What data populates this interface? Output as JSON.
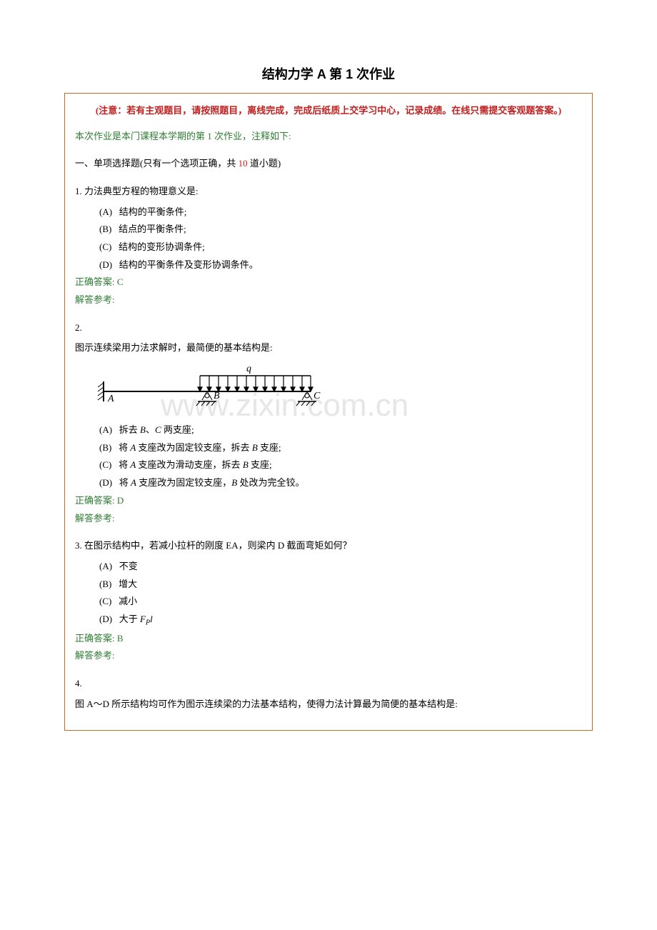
{
  "title": "结构力学 A 第 1 次作业",
  "notice": "(注意：若有主观题目，请按照题目，离线完成，完成后纸质上交学习中心，记录成绩。在线只需提交客观题答案。)",
  "intro": "本次作业是本门课程本学期的第 1 次作业，注释如下:",
  "section_head_pre": "一、单项选择题(只有一个选项正确，共 ",
  "section_head_count": "10",
  "section_head_post": " 道小题)",
  "q1": {
    "num": "1.",
    "stem": "力法典型方程的物理意义是:",
    "opts": {
      "A": "(A)   结构的平衡条件;",
      "B": "(B)   结点的平衡条件;",
      "C": "(C)   结构的变形协调条件;",
      "D": "(D)   结构的平衡条件及变形协调条件。"
    },
    "answer": "正确答案: C",
    "ref": "解答参考:"
  },
  "q2": {
    "num": "2.",
    "stem": "图示连续梁用力法求解时，最简便的基本结构是:",
    "diagram": {
      "A": "A",
      "B": "B",
      "C": "C",
      "q": "q"
    },
    "optA_pre": "(A)   拆去 ",
    "optA_B": "B",
    "optA_mid": "、",
    "optA_C": "C",
    "optA_post": " 两支座;",
    "optB_pre": "(B)   将 ",
    "optB_A": "A",
    "optB_mid1": " 支座改为固定铰支座，拆去 ",
    "optB_B": "B",
    "optB_post": " 支座;",
    "optC_pre": "(C)   将 ",
    "optC_A": "A",
    "optC_mid1": " 支座改为滑动支座，拆去 ",
    "optC_B": "B",
    "optC_post": " 支座;",
    "optD_pre": "(D)   将 ",
    "optD_A": "A",
    "optD_mid1": " 支座改为固定铰支座，",
    "optD_B": "B",
    "optD_post": " 处改为完全铰。",
    "answer": "正确答案: D",
    "ref": "解答参考:"
  },
  "q3": {
    "num": "3.",
    "stem": "在图示结构中，若减小拉杆的刚度 EA，则梁内 D 截面弯矩如何？",
    "opts": {
      "A": "(A)   不变",
      "B": "(B)   增大",
      "C": "(C)   减小"
    },
    "optD_pre": "(D)   大于 ",
    "optD_F": "F",
    "optD_P": "P",
    "optD_l": "l",
    "answer": "正确答案: B",
    "ref": "解答参考:"
  },
  "q4": {
    "num": "4.",
    "stem": " 图 A～D 所示结构均可作为图示连续梁的力法基本结构，使得力法计算最为简便的基本结构是:"
  },
  "watermark": "www.zixin.com.cn"
}
